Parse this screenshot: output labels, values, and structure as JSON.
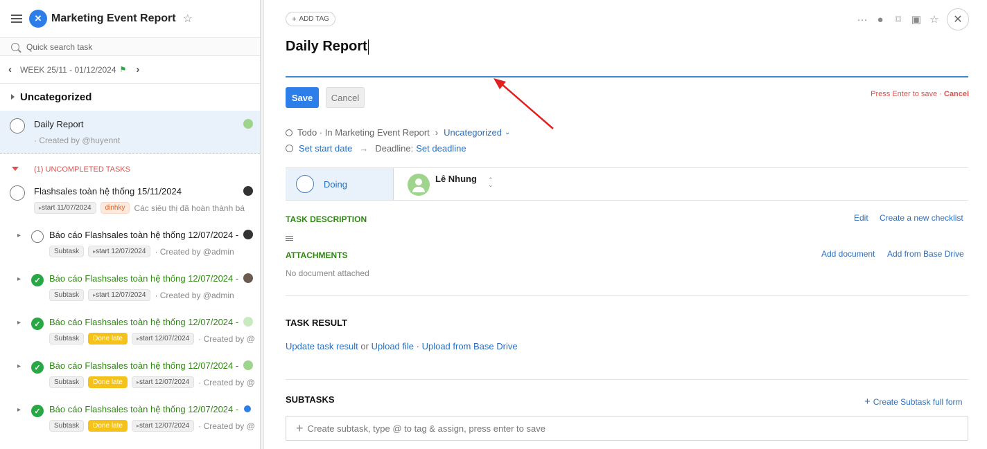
{
  "project": {
    "title": "Marketing Event Report"
  },
  "search": {
    "placeholder": "Quick search task"
  },
  "week": {
    "label": "WEEK 25/11 - 01/12/2024"
  },
  "category": {
    "label": "Uncategorized"
  },
  "selected_task": {
    "name": "Daily Report",
    "creator": "· Created by @huyennt"
  },
  "uncompleted": {
    "label": "(1) UNCOMPLETED TASKS"
  },
  "tasks": [
    {
      "name": "Flashsales toàn hệ thống 15/11/2024",
      "start": "start 11/07/2024",
      "tag": "dinhky",
      "desc": "Các siêu thị đã hoàn thành bá"
    },
    {
      "name": "Báo cáo Flashsales toàn hệ thống 12/07/2024 -",
      "badge": "Subtask",
      "start": "start 12/07/2024",
      "creator": "· Created by @admin"
    },
    {
      "name": "Báo cáo Flashsales toàn hệ thống 12/07/2024 -",
      "badge": "Subtask",
      "start": "start 12/07/2024",
      "creator": "· Created by @admin"
    },
    {
      "name": "Báo cáo Flashsales toàn hệ thống 12/07/2024 -",
      "badge": "Subtask",
      "late": "Done late",
      "start": "start 12/07/2024",
      "creator": "· Created by @"
    },
    {
      "name": "Báo cáo Flashsales toàn hệ thống 12/07/2024 -",
      "badge": "Subtask",
      "late": "Done late",
      "start": "start 12/07/2024",
      "creator": "· Created by @"
    },
    {
      "name": "Báo cáo Flashsales toàn hệ thống 12/07/2024 -",
      "badge": "Subtask",
      "late": "Done late",
      "start": "start 12/07/2024",
      "creator": "· Created by @"
    }
  ],
  "detail": {
    "add_tag": "ADD TAG",
    "title": "Daily Report",
    "save": "Save",
    "cancel": "Cancel",
    "enter_hint": "Press Enter to save ·",
    "enter_cancel": "Cancel",
    "status": "Todo · In Marketing Event Report",
    "sep": "›",
    "category": "Uncategorized",
    "set_start": "Set start date",
    "deadline_label": "Deadline:",
    "set_deadline": "Set deadline",
    "doing": "Doing",
    "assignee": "Lê Nhung",
    "task_description": "TASK DESCRIPTION",
    "edit": "Edit",
    "create_checklist": "Create a new checklist",
    "attachments": "ATTACHMENTS",
    "add_document": "Add document",
    "add_from_drive": "Add from Base Drive",
    "no_document": "No document attached",
    "task_result": "TASK RESULT",
    "update_result": "Update task result",
    "or": " or ",
    "upload_file": "Upload file",
    "dot": " · ",
    "upload_drive": "Upload from Base Drive",
    "subtasks": "SUBTASKS",
    "create_subtask_full": "Create Subtask full form",
    "subtask_placeholder": "Create subtask, type @ to tag & assign, press enter to save"
  },
  "colors": {
    "accent": "#2d7ee8",
    "green": "#2f8a12",
    "danger": "#d9534f",
    "arrow": "#e02020"
  }
}
